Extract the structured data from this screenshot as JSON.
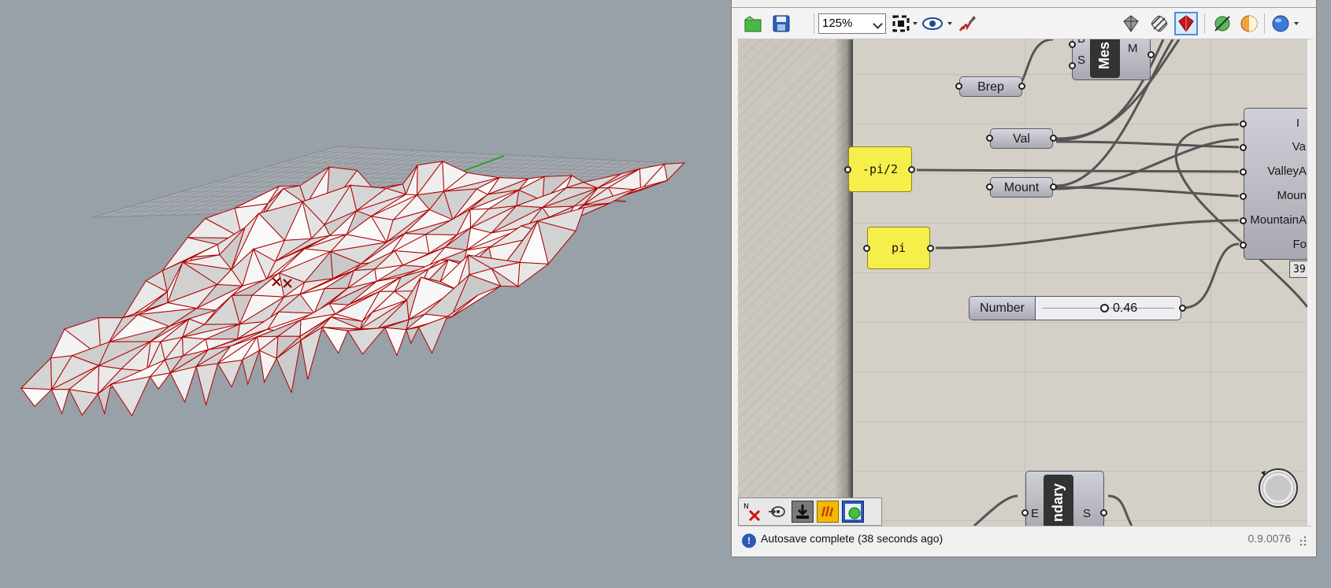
{
  "toolbar": {
    "zoom_level": "125%",
    "icons": [
      "open-file-icon",
      "save-icon",
      "zoom-extents-icon",
      "preview-eye-icon",
      "sketch-pen-icon",
      "preview-wireframe-icon",
      "preview-shaded-icon",
      "preview-selected-icon",
      "bake-icon",
      "display-material-icon",
      "sphere-icon"
    ]
  },
  "canvas": {
    "params": {
      "brep": "Brep",
      "val": "Val",
      "mount": "Mount",
      "neg_pi_half": "-pi/2",
      "pi": "pi"
    },
    "mesh_component": {
      "name": "Mes",
      "inputs": [
        "B",
        "S"
      ],
      "output": "M"
    },
    "fold_component": {
      "inputs": [
        "I",
        "Va",
        "ValleyA",
        "Moun",
        "MountainA",
        "Fo"
      ],
      "readout": "39("
    },
    "boundary_component": {
      "name": "ndary",
      "input": "E",
      "output": "S"
    },
    "slider": {
      "label": "Number",
      "value": "0.46",
      "position_fraction": 0.46
    }
  },
  "bottom_tools": [
    "clear-solution-icon",
    "redo-solution-icon",
    "download-icon",
    "sound-icon",
    "preview-toggle-icon"
  ],
  "status": {
    "message": "Autosave complete (38 seconds ago)",
    "version": "0.9.0076"
  },
  "colors": {
    "viewport_bg": "#98a0a8",
    "mesh_edge": "#b00000",
    "canvas_bg": "#d4d0c8",
    "param_yellow": "#f6ee4a"
  }
}
